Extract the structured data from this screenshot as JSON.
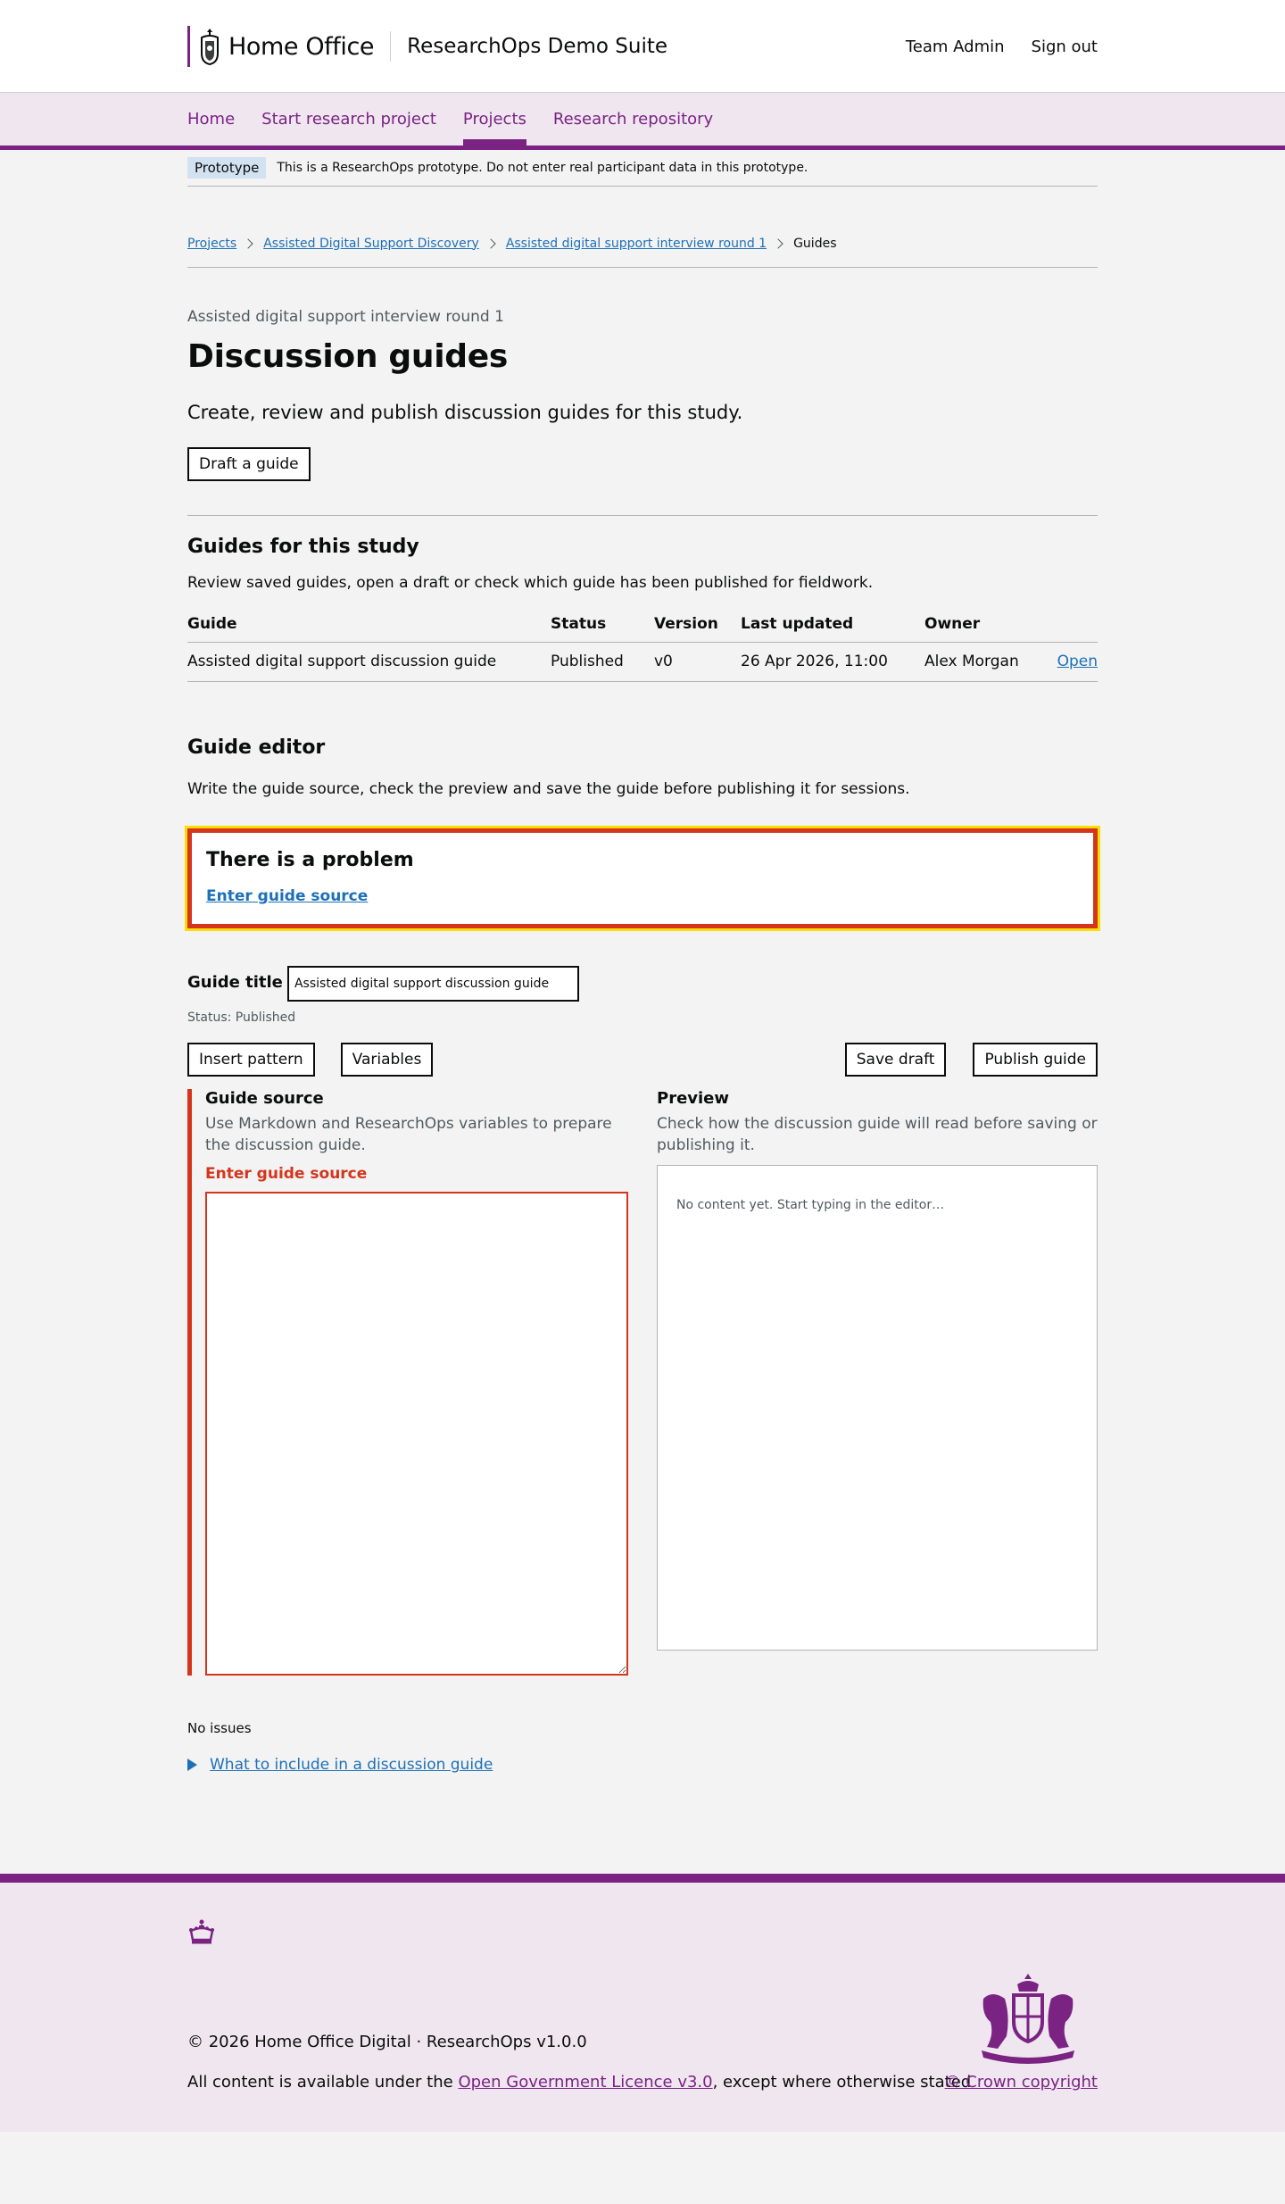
{
  "header": {
    "org_name": "Home Office",
    "service_name": "ResearchOps Demo Suite",
    "links": [
      "Team Admin",
      "Sign out"
    ]
  },
  "nav": {
    "items": [
      "Home",
      "Start research project",
      "Projects",
      "Research repository"
    ],
    "active": "Projects"
  },
  "phase": {
    "tag": "Prototype",
    "text": "This is a ResearchOps prototype. Do not enter real participant data in this prototype."
  },
  "breadcrumbs": [
    "Projects",
    "Assisted Digital Support Discovery",
    "Assisted digital support interview round 1",
    "Guides"
  ],
  "page": {
    "caption": "Assisted digital support interview round 1",
    "title": "Discussion guides",
    "lead": "Create, review and publish discussion guides for this study.",
    "draft_button": "Draft a guide"
  },
  "guides": {
    "heading": "Guides for this study",
    "description": "Review saved guides, open a draft or check which guide has been published for fieldwork.",
    "columns": [
      "Guide",
      "Status",
      "Version",
      "Last updated",
      "Owner"
    ],
    "rows": [
      {
        "guide": "Assisted digital support discussion guide",
        "status": "Published",
        "version": "v0",
        "updated": "26 Apr 2026, 11:00",
        "owner": "Alex Morgan",
        "action": "Open"
      }
    ]
  },
  "editor": {
    "heading": "Guide editor",
    "description": "Write the guide source, check the preview and save the guide before publishing it for sessions.",
    "error_summary": {
      "title": "There is a problem",
      "link": "Enter guide source"
    },
    "title_label": "Guide title",
    "title_value": "Assisted digital support discussion guide",
    "status_hint": "Status: Published",
    "buttons": {
      "insert_pattern": "Insert pattern",
      "variables": "Variables",
      "save_draft": "Save draft",
      "publish": "Publish guide"
    },
    "source_label": "Guide source",
    "source_hint": "Use Markdown and ResearchOps variables to prepare the discussion guide.",
    "source_error": "Enter guide source",
    "preview_label": "Preview",
    "preview_hint": "Check how the discussion guide will read before saving or publishing it.",
    "preview_empty": "No content yet. Start typing in the editor…",
    "issues": "No issues",
    "details_summary": "What to include in a discussion guide"
  },
  "footer": {
    "copyright": "© 2026 Home Office Digital · ResearchOps v1.0.0",
    "licence_prefix": "All content is available under the ",
    "licence_link": "Open Government Licence v3.0",
    "licence_suffix": ", except where otherwise stated",
    "crown_copyright": "© Crown copyright"
  },
  "colors": {
    "brand_purple": "#7a2383",
    "link_blue": "#1d70b8",
    "error_red": "#d4351c",
    "focus_yellow": "#ffdd00"
  }
}
